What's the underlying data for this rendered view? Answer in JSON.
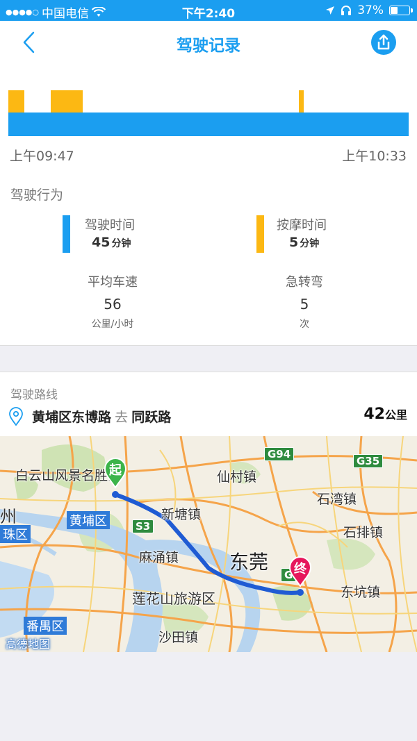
{
  "status_bar": {
    "carrier": "中国电信",
    "time": "下午2:40",
    "battery": "37%",
    "battery_level": 0.37
  },
  "nav": {
    "title": "驾驶记录",
    "back_icon": "chevron-left-icon",
    "share_icon": "share-icon"
  },
  "timeline": {
    "start_time": "上午09:47",
    "end_time": "上午10:33",
    "colors": {
      "driving": "#1b9ef0",
      "massage": "#fcb813"
    }
  },
  "behavior": {
    "section_title": "驾驶行为",
    "drive_time": {
      "label": "驾驶时间",
      "value": "45",
      "unit": "分钟"
    },
    "massage_time": {
      "label": "按摩时间",
      "value": "5",
      "unit": "分钟"
    },
    "avg_speed": {
      "label": "平均车速",
      "value": "56",
      "unit": "公里/小时"
    },
    "sharp_turns": {
      "label": "急转弯",
      "value": "5",
      "unit": "次"
    }
  },
  "route": {
    "section_title": "驾驶路线",
    "from": "黄埔区东博路",
    "via_word": "去",
    "to": "同跃路",
    "distance": "42",
    "distance_unit": "公里"
  },
  "map": {
    "start_marker": "起",
    "end_marker": "终",
    "labels": {
      "baiyun": "白云山风景名胜区",
      "huangpu": "黄埔区",
      "zhou": "州",
      "zhuqu": "珠区",
      "xiantang": "新塘镇",
      "mayong": "麻涌镇",
      "dongguan": "东莞",
      "lianhua": "莲花山旅游区",
      "shatian": "沙田镇",
      "panyu": "番禺区",
      "xiancun": "仙村镇",
      "shiwan": "石湾镇",
      "shipai": "石排镇",
      "dongkeng": "东坑镇",
      "g94": "G94",
      "g35": "G35",
      "s3": "S3",
      "g_partial": "G",
      "gaode": "高德地图"
    }
  }
}
